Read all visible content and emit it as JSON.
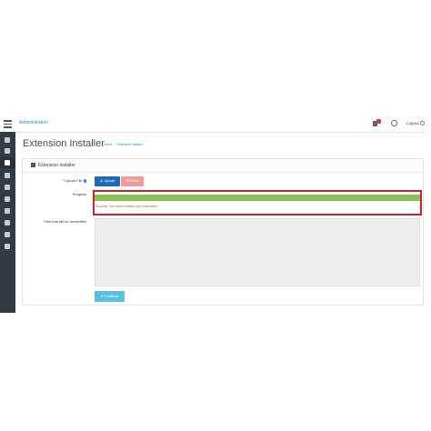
{
  "header": {
    "brand": "Administration",
    "logout_label": "Logout"
  },
  "sidebar": {
    "items": [
      {
        "icon": "dashboard-icon"
      },
      {
        "icon": "tag-icon"
      },
      {
        "icon": "puzzle-icon",
        "active": true
      },
      {
        "icon": "cart-icon"
      },
      {
        "icon": "user-icon"
      },
      {
        "icon": "share-icon"
      },
      {
        "icon": "gear-icon"
      },
      {
        "icon": "desktop-icon"
      },
      {
        "icon": "wrench-icon"
      },
      {
        "icon": "chart-icon"
      }
    ]
  },
  "page": {
    "title": "Extension Installer",
    "breadcrumb": [
      "Home",
      "Extension Installer"
    ]
  },
  "panel": {
    "title": "Extension Installer",
    "upload_label": "* Upload File",
    "upload_button": "Upload",
    "clear_button": "Clear",
    "progress_label": "Progress",
    "progress_percent": 100,
    "success_message": "Success: You have installed your extension!",
    "overwrite_label": "Files that will be overwritten",
    "continue_button": "Continue"
  },
  "colors": {
    "accent": "#1e91cf",
    "progress": "#8cc152",
    "highlight_border": "#d0212a",
    "sidebar": "#323a45"
  }
}
